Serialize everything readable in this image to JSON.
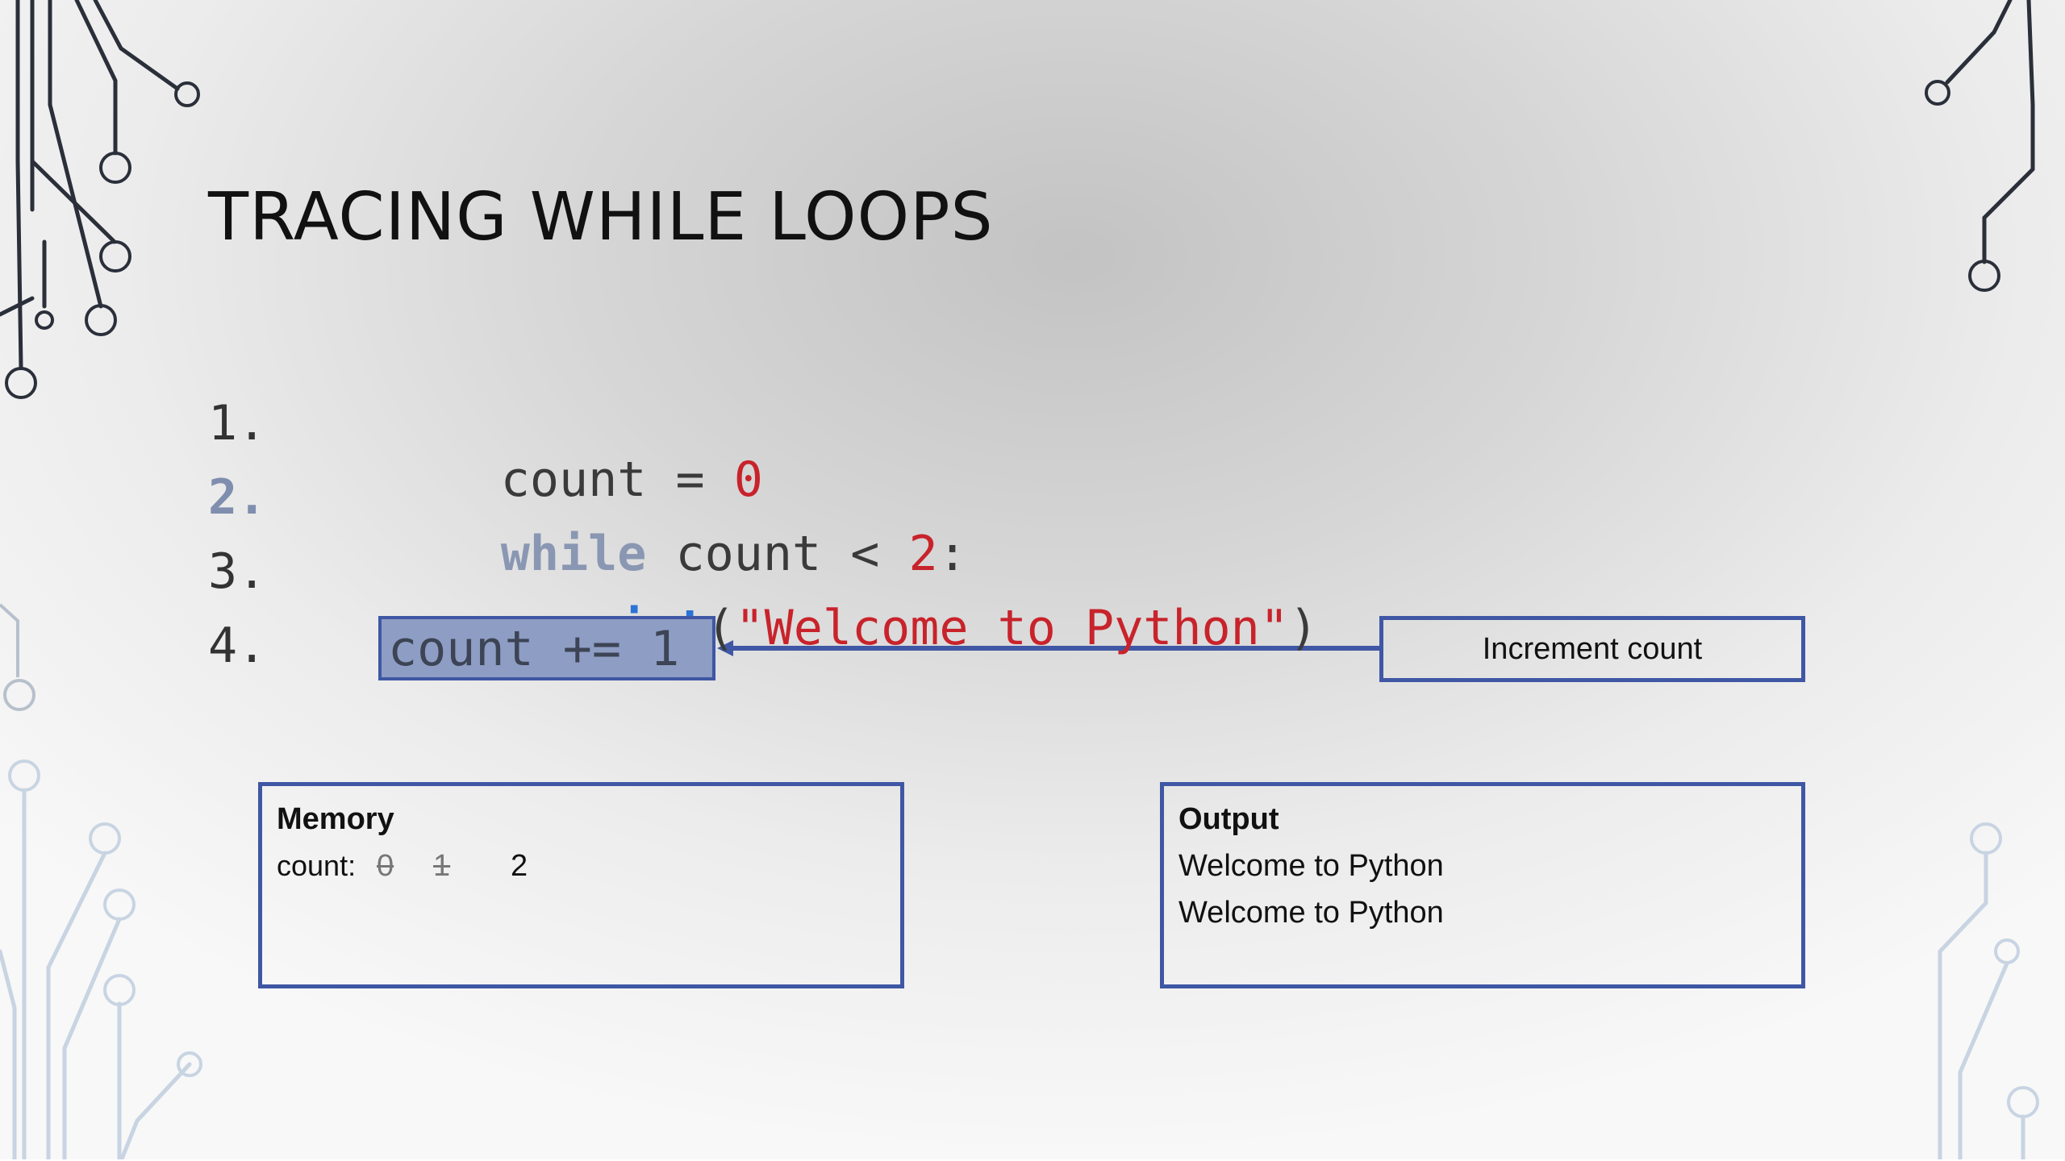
{
  "slide": {
    "title": "TRACING WHILE LOOPS"
  },
  "code": {
    "current_line": 2,
    "lines": [
      {
        "number": "1.",
        "text_1": "count = ",
        "value": "0"
      },
      {
        "number": "2.",
        "keyword": "while",
        "text_1": " count < ",
        "value": "2",
        "text_2": ":"
      },
      {
        "number": "3.",
        "keyword": "print",
        "text_1": "(",
        "string": "\"Welcome to Python\"",
        "text_2": ")"
      },
      {
        "number": "4.",
        "text_1": "count += 1"
      }
    ]
  },
  "callout": {
    "label": "Increment count"
  },
  "memory": {
    "title": "Memory",
    "variable": "count:",
    "history": [
      "0",
      "1"
    ],
    "current": "2"
  },
  "output": {
    "title": "Output",
    "lines": [
      "Welcome to Python",
      "Welcome to Python"
    ]
  },
  "colors": {
    "accent_blue": "#3f57a4",
    "highlight_fill": "#8e9dc3",
    "keyword_blue": "#2b73d6",
    "literal_red": "#c8232b",
    "current_line_number": "#7f8eae"
  }
}
